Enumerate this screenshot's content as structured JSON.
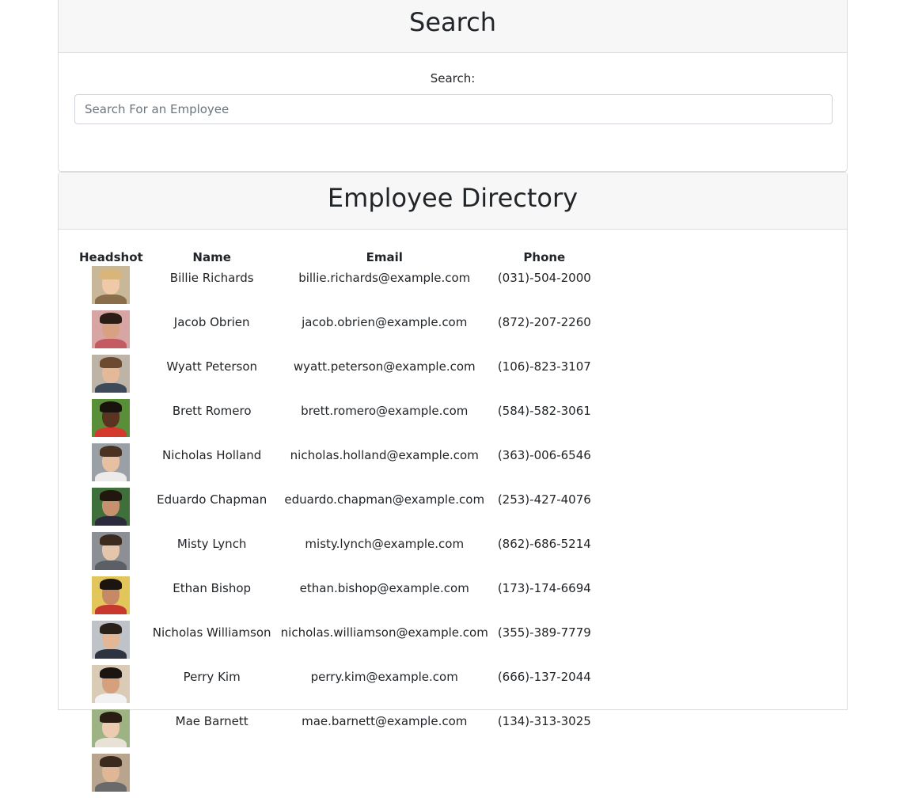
{
  "search_card": {
    "title": "Search",
    "label": "Search:",
    "placeholder": "Search For an Employee"
  },
  "directory_card": {
    "title": "Employee Directory",
    "columns": [
      "Headshot",
      "Name",
      "Email",
      "Phone"
    ],
    "employees": [
      {
        "name": "Billie Richards",
        "email": "billie.richards@example.com",
        "phone": "(031)-504-2000",
        "photo": {
          "bg": "#c9b79a",
          "skin": "#f0c9a8",
          "hair": "#d8b57a",
          "shirt": "#8a6e4c"
        }
      },
      {
        "name": "Jacob Obrien",
        "email": "jacob.obrien@example.com",
        "phone": "(872)-207-2260",
        "photo": {
          "bg": "#d8a5a5",
          "skin": "#d9a184",
          "hair": "#2b1d16",
          "shirt": "#c45b63"
        }
      },
      {
        "name": "Wyatt Peterson",
        "email": "wyatt.peterson@example.com",
        "phone": "(106)-823-3107",
        "photo": {
          "bg": "#bdb3a6",
          "skin": "#e3b99a",
          "hair": "#6b4a30",
          "shirt": "#3e4a5a"
        }
      },
      {
        "name": "Brett Romero",
        "email": "brett.romero@example.com",
        "phone": "(584)-582-3061",
        "photo": {
          "bg": "#5a8f3a",
          "skin": "#5a3420",
          "hair": "#1a120c",
          "shirt": "#d43a2c"
        }
      },
      {
        "name": "Nicholas Holland",
        "email": "nicholas.holland@example.com",
        "phone": "(363)-006-6546",
        "photo": {
          "bg": "#9aa0a6",
          "skin": "#e7c0a2",
          "hair": "#4a3322",
          "shirt": "#ecebea"
        }
      },
      {
        "name": "Eduardo Chapman",
        "email": "eduardo.chapman@example.com",
        "phone": "(253)-427-4076",
        "photo": {
          "bg": "#3f6f3a",
          "skin": "#c6916c",
          "hair": "#21170f",
          "shirt": "#2c2b3c"
        }
      },
      {
        "name": "Misty Lynch",
        "email": "misty.lynch@example.com",
        "phone": "(862)-686-5214",
        "photo": {
          "bg": "#8c8f93",
          "skin": "#e6c5ad",
          "hair": "#3a2a20",
          "shirt": "#5c5f66"
        }
      },
      {
        "name": "Ethan Bishop",
        "email": "ethan.bishop@example.com",
        "phone": "(173)-174-6694",
        "photo": {
          "bg": "#e2c65b",
          "skin": "#c58964",
          "hair": "#1c140f",
          "shirt": "#c7382e"
        }
      },
      {
        "name": "Nicholas Williamson",
        "email": "nicholas.williamson@example.com",
        "phone": "(355)-389-7779",
        "photo": {
          "bg": "#bfc3c7",
          "skin": "#e3b696",
          "hair": "#2a211b",
          "shirt": "#2d3440"
        }
      },
      {
        "name": "Perry Kim",
        "email": "perry.kim@example.com",
        "phone": "(666)-137-2044",
        "photo": {
          "bg": "#d9cbb6",
          "skin": "#d6a07c",
          "hair": "#1b1410",
          "shirt": "#f2f2f2"
        }
      },
      {
        "name": "Mae Barnett",
        "email": "mae.barnett@example.com",
        "phone": "(134)-313-3025",
        "photo": {
          "bg": "#9db384",
          "skin": "#edcbb0",
          "hair": "#2a1d14",
          "shirt": "#e8e2d6"
        }
      },
      {
        "name": "",
        "email": "",
        "phone": "",
        "photo": {
          "bg": "#b9a58e",
          "skin": "#e0b796",
          "hair": "#3b2a1e",
          "shirt": "#6a6a6a"
        }
      }
    ]
  }
}
